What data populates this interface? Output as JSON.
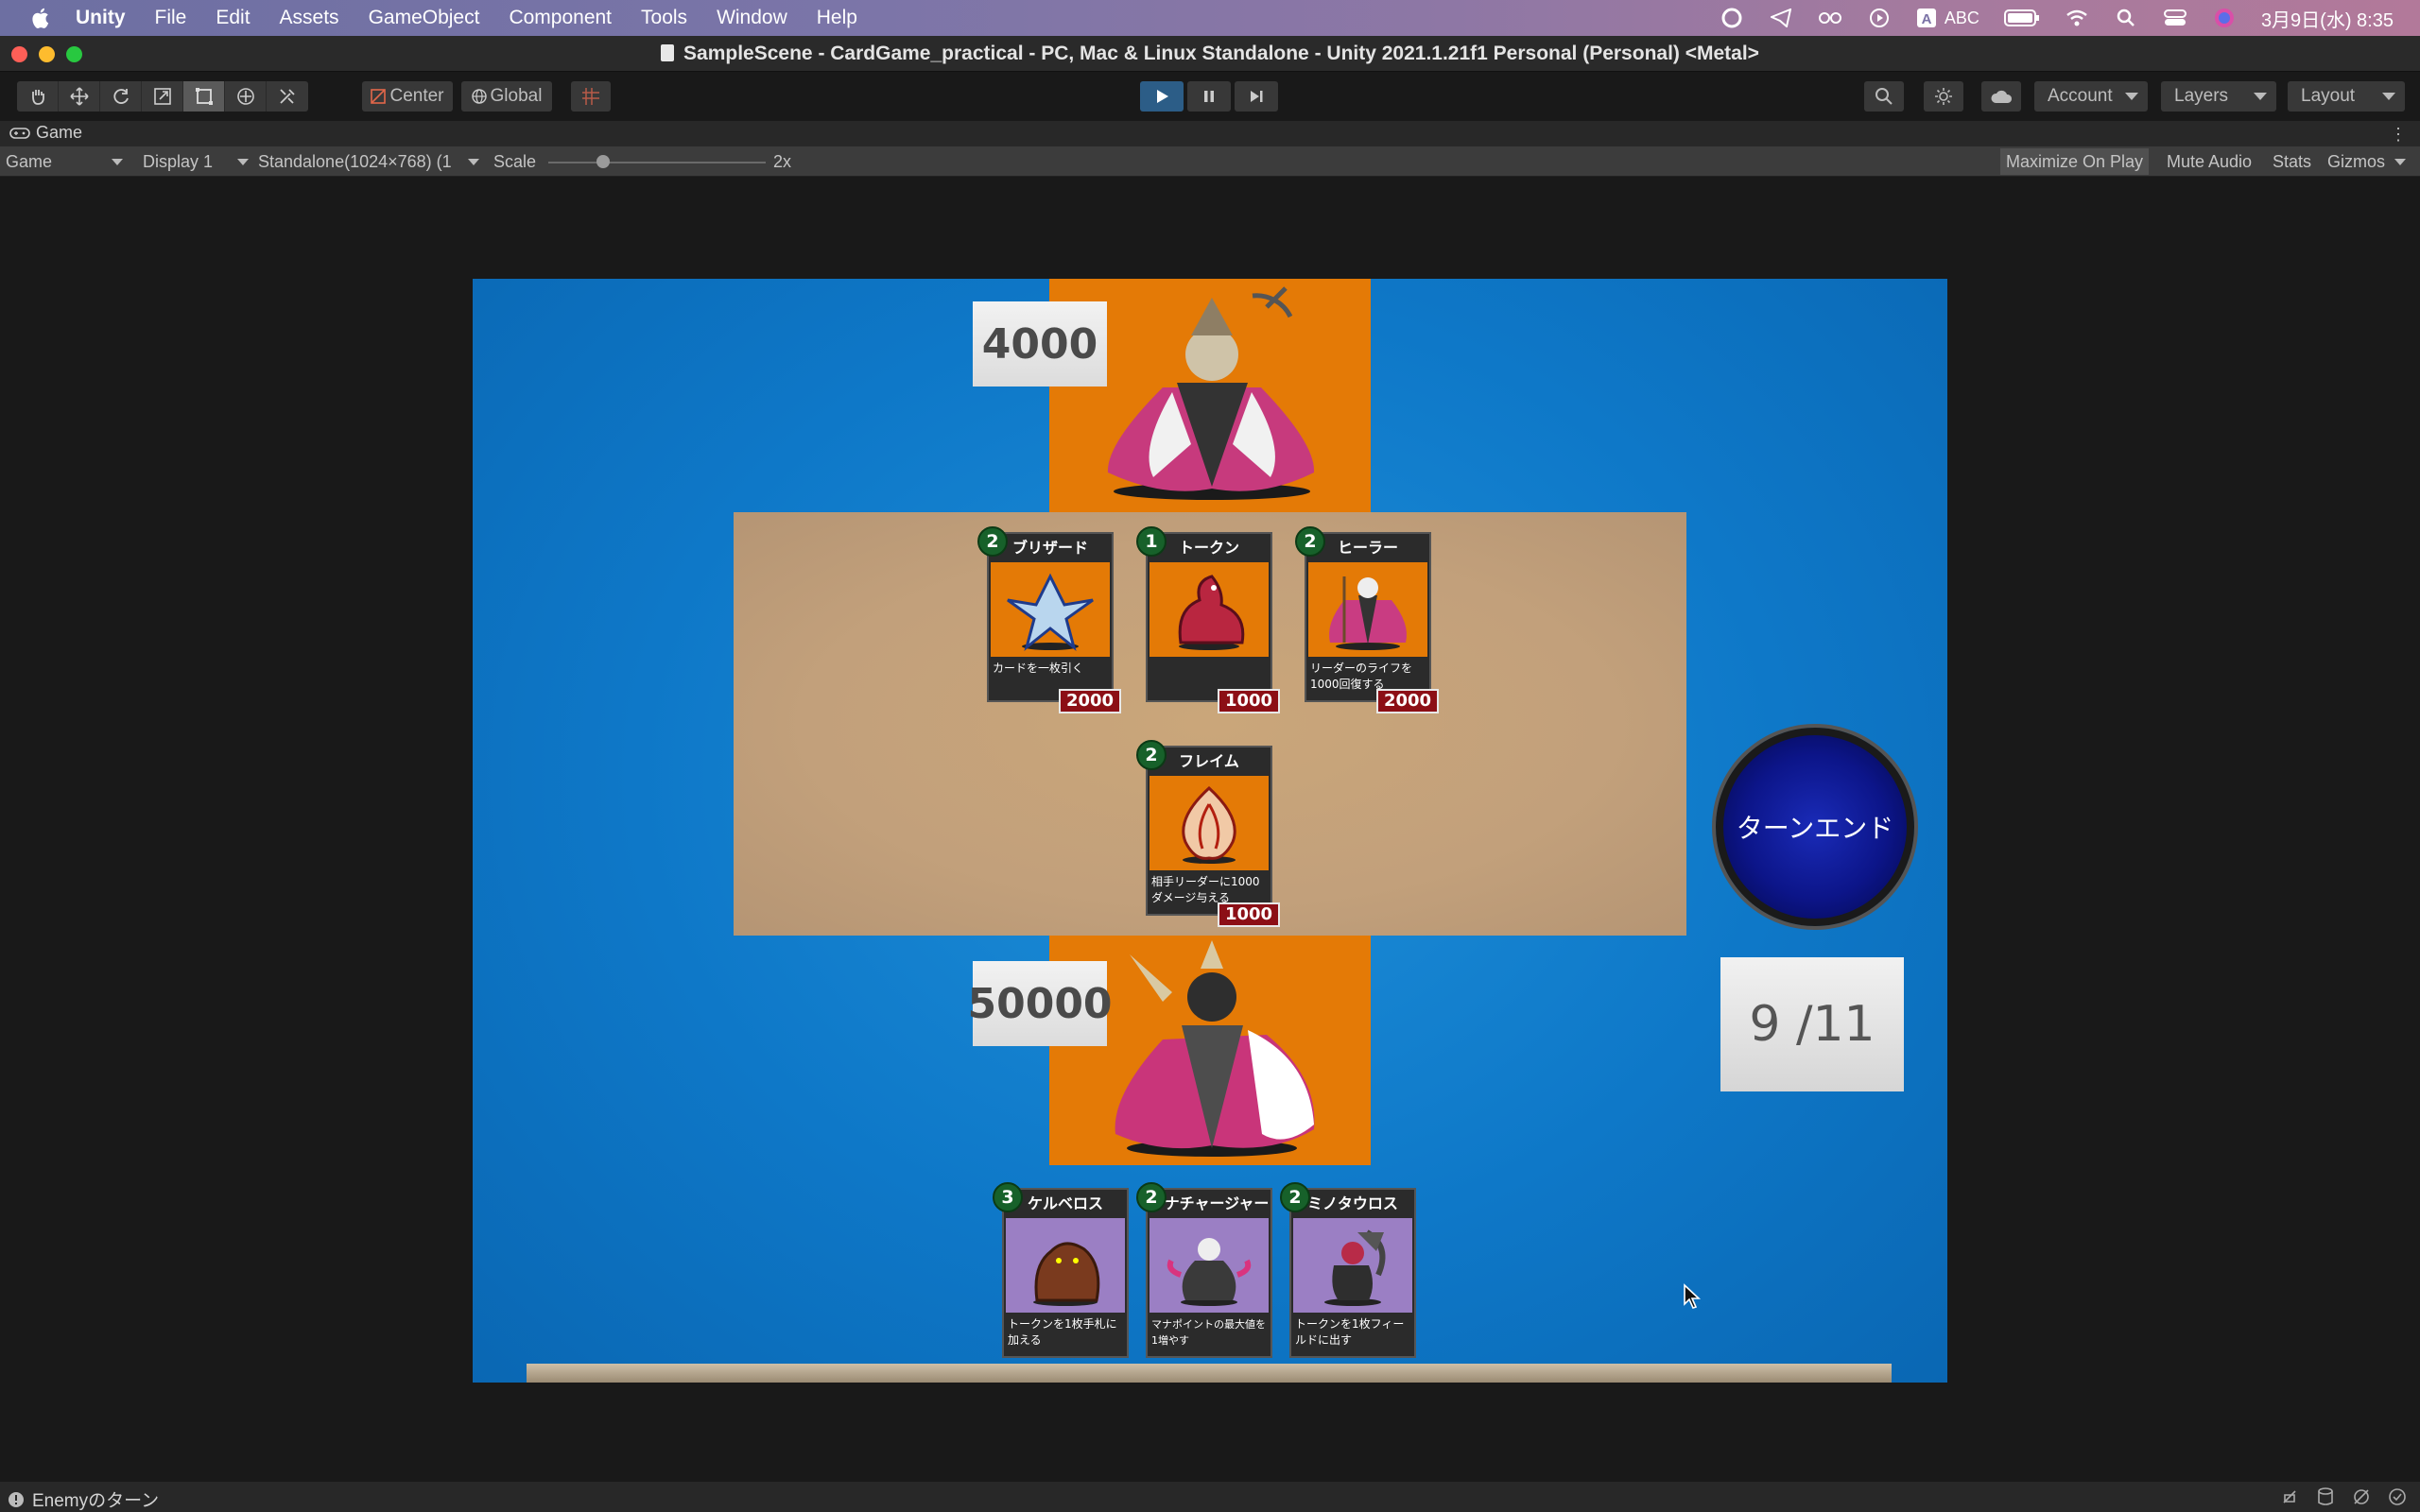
{
  "menubar": {
    "app_name": "Unity",
    "items": [
      "File",
      "Edit",
      "Assets",
      "GameObject",
      "Component",
      "Tools",
      "Window",
      "Help"
    ],
    "input_mode": "ABC",
    "clock": "3月9日(水)  8:35"
  },
  "window": {
    "title": "SampleScene - CardGame_practical - PC, Mac & Linux Standalone - Unity 2021.1.21f1 Personal (Personal) <Metal>"
  },
  "toolbar": {
    "pivot": "Center",
    "space": "Global",
    "account": "Account",
    "layers": "Layers",
    "layout": "Layout"
  },
  "game_tab": {
    "label": "Game",
    "view": "Game",
    "display": "Display 1",
    "resolution": "Standalone(1024×768) (1",
    "scale_label": "Scale",
    "scale_value": "2x",
    "scale_fraction": 0.25,
    "maximize": "Maximize On Play",
    "mute": "Mute Audio",
    "stats": "Stats",
    "gizmos": "Gizmos"
  },
  "game": {
    "enemy_life": "4000",
    "player_life": "50000",
    "mana": "9 /11",
    "turn_end_label": "ターンエンド",
    "field_cards": [
      {
        "name": "ブリザード",
        "cost": "2",
        "attack": "2000",
        "text": "カードを一枚引く",
        "icon": "ice-creature"
      },
      {
        "name": "トークン",
        "cost": "1",
        "attack": "1000",
        "text": "",
        "icon": "dragon-token"
      },
      {
        "name": "ヒーラー",
        "cost": "2",
        "attack": "2000",
        "text": "リーダーのライフを1000回復する",
        "icon": "healer"
      },
      {
        "name": "フレイム",
        "cost": "2",
        "attack": "1000",
        "text": "相手リーダーに1000ダメージ与える",
        "icon": "flame"
      }
    ],
    "hand_cards": [
      {
        "name": "ケルベロス",
        "cost": "3",
        "text": "トークンを1枚手札に加える",
        "icon": "cerberus"
      },
      {
        "name": "マナチャージャー",
        "cost": "2",
        "text": "マナポイントの最大値を1増やす",
        "icon": "mana-charger"
      },
      {
        "name": "ミノタウロス",
        "cost": "2",
        "text": "トークンを1枚フィールドに出す",
        "icon": "minotaur"
      }
    ]
  },
  "status": {
    "message": "Enemyのターン"
  },
  "colors": {
    "table_blue": "#0e78c8",
    "leader_orange": "#e47a06",
    "cost_green": "#17612a",
    "attack_red": "#8c0f16"
  }
}
